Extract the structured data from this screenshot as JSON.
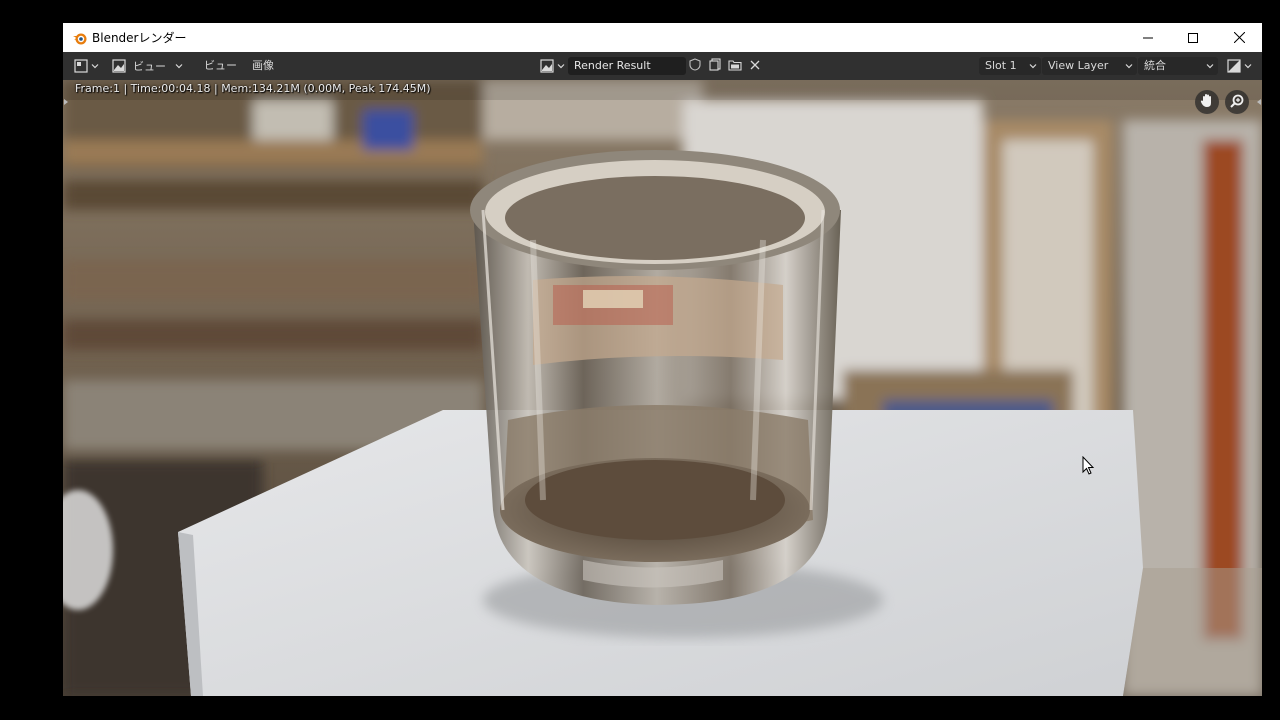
{
  "window": {
    "title": "Blenderレンダー",
    "icon": "blender-logo-icon",
    "controls": [
      "minimize-icon",
      "maximize-icon",
      "close-icon"
    ]
  },
  "header": {
    "editor_type_icon": "image-editor-icon",
    "view_mode_icon": "image-view-icon",
    "view_mode_label": "ビュー",
    "menus": {
      "view": "ビュー",
      "image": "画像"
    },
    "browse_image_icon": "image-browse-icon",
    "image_name": "Render Result",
    "fake_user_icon": "shield-icon",
    "new_image_icon": "new-image-icon",
    "open_image_icon": "folder-icon",
    "unlink_icon": "close-icon",
    "slot": "Slot 1",
    "view_layer": "View Layer",
    "pass": "統合",
    "display_channels_icon": "display-channels-icon"
  },
  "render": {
    "stats": "Frame:1 | Time:00:04.18 | Mem:134.21M (0.00M, Peak 174.45M)",
    "nav_icons": [
      "hand-pan-icon",
      "zoom-icon"
    ]
  },
  "colors": {
    "titlebar_bg": "#ffffff",
    "header_bg": "#303030",
    "field_bg": "#1f1f1f",
    "text": "#d9d9d9"
  }
}
